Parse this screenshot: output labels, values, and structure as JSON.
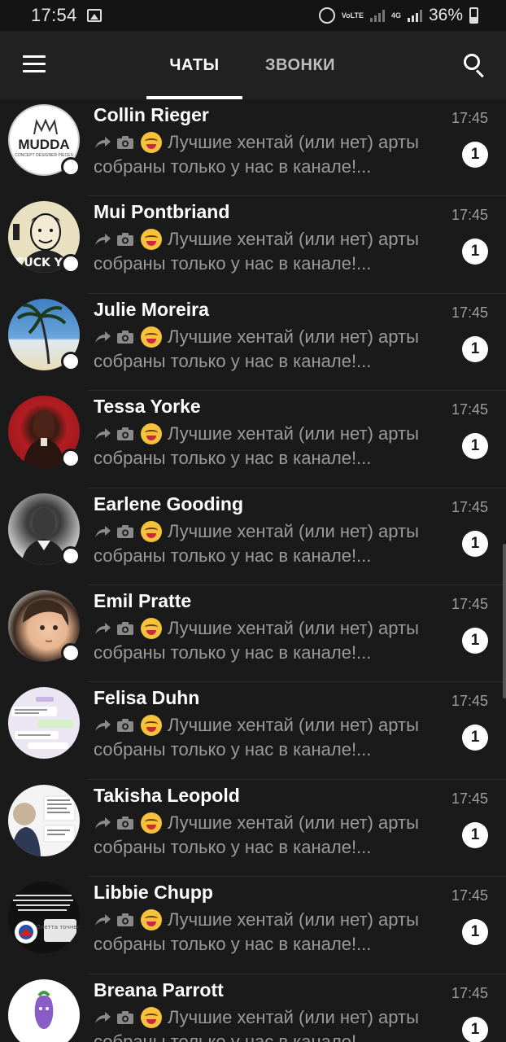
{
  "status_bar": {
    "time": "17:54",
    "network_labels": [
      "VoLTE",
      "4G"
    ],
    "battery": "36%"
  },
  "app_bar": {
    "tabs": [
      {
        "label": "ЧАТЫ",
        "active": true
      },
      {
        "label": "ЗВОНКИ",
        "active": false
      }
    ]
  },
  "chats": [
    {
      "name": "Collin Rieger",
      "time": "17:45",
      "line1": "Лучшие хентай (или нет) арты",
      "line2": "собраны только у нас в канале!...",
      "unread": "1",
      "avatar_text": "MUDDA",
      "avatar_subtext": "CONCEPT DESIGNER PIECES"
    },
    {
      "name": "Mui Pontbriand",
      "time": "17:45",
      "line1": "Лучшие хентай (или нет) арты",
      "line2": "собраны только у нас в канале!...",
      "unread": "1",
      "avatar_text": "FUCK YO"
    },
    {
      "name": "Julie Moreira",
      "time": "17:45",
      "line1": "Лучшие хентай (или нет) арты",
      "line2": "собраны только у нас в канале!...",
      "unread": "1"
    },
    {
      "name": "Tessa Yorke",
      "time": "17:45",
      "line1": "Лучшие хентай (или нет) арты",
      "line2": "собраны только у нас в канале!...",
      "unread": "1"
    },
    {
      "name": "Earlene Gooding",
      "time": "17:45",
      "line1": "Лучшие хентай (или нет) арты",
      "line2": "собраны только у нас в канале!...",
      "unread": "1"
    },
    {
      "name": "Emil Pratte",
      "time": "17:45",
      "line1": "Лучшие хентай (или нет) арты",
      "line2": "собраны только у нас в канале!...",
      "unread": "1"
    },
    {
      "name": "Felisa Duhn",
      "time": "17:45",
      "line1": "Лучшие хентай (или нет) арты",
      "line2": "собраны только у нас в канале!...",
      "unread": "1"
    },
    {
      "name": "Takisha Leopold",
      "time": "17:45",
      "line1": "Лучшие хентай (или нет) арты",
      "line2": "собраны только у нас в канале!...",
      "unread": "1"
    },
    {
      "name": "Libbie Chupp",
      "time": "17:45",
      "line1": "Лучшие хентай (или нет) арты",
      "line2": "собраны только у нас в канале!...",
      "unread": "1",
      "avatar_text": "Юлетта точнее..."
    },
    {
      "name": "Breana Parrott",
      "time": "17:45",
      "line1": "Лучшие хентай (или нет) арты",
      "line2": "собраны только у нас в канале!...",
      "unread": "1"
    }
  ],
  "icons": {
    "preview_prefix": [
      "forward-icon",
      "camera-icon",
      "smile-emoji-icon"
    ],
    "header": [
      "menu-icon",
      "search-icon"
    ]
  },
  "colors": {
    "background": "#1a1a1a",
    "app_bar": "#212121",
    "name": "#ffffff",
    "preview": "#9a9a9a",
    "badge": "#ffffff"
  }
}
